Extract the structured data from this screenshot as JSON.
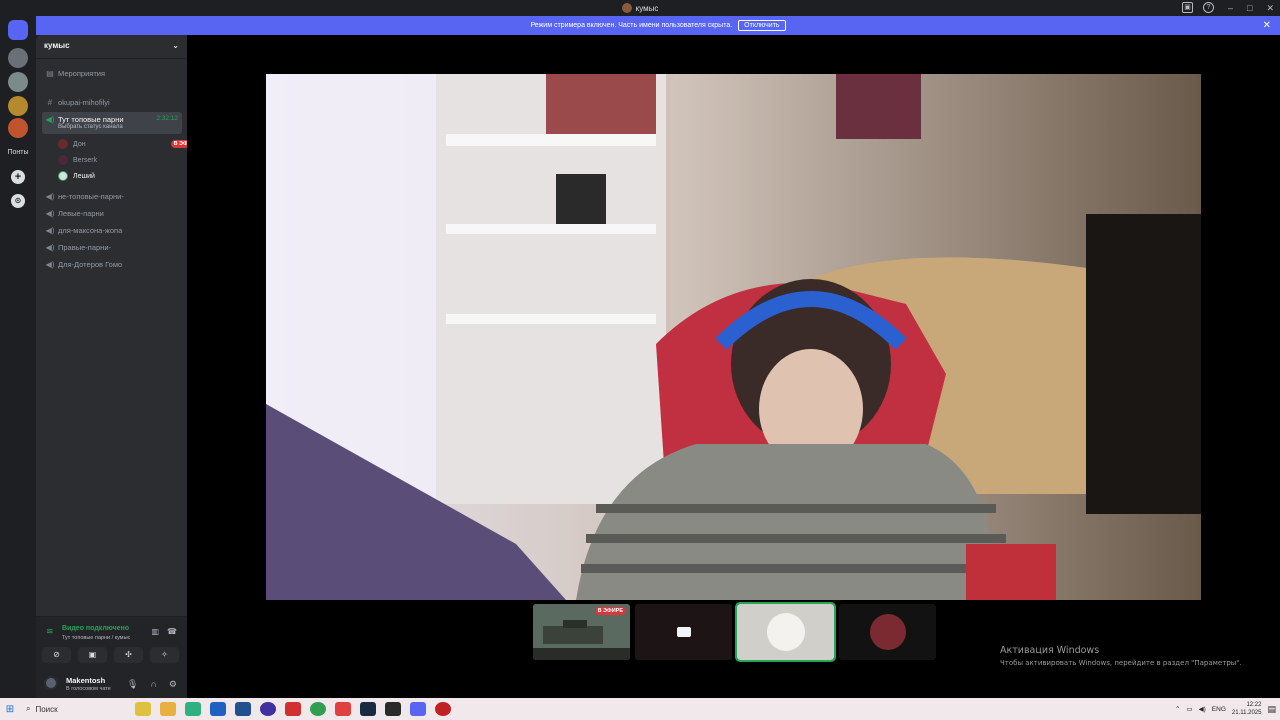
{
  "window": {
    "title": "кумыс"
  },
  "banner": {
    "text": "Режим стримера включен. Часть имени пользователя скрыта.",
    "button": "Отключить",
    "color": "#5865f2"
  },
  "rail": {
    "folder_label": "Понты"
  },
  "server": {
    "name": "кумыс"
  },
  "channels": {
    "events": "Мероприятия",
    "text_channel": "okupai-mihofilyi",
    "active_voice": {
      "name": "Тут топовые парни",
      "timer": "2:32:12",
      "status_hint": "Выбрать статус канала"
    },
    "members": [
      {
        "name": "Дон",
        "badge": "В ЭФИРЕ"
      },
      {
        "name": "Berserk"
      },
      {
        "name": "Леший"
      }
    ],
    "voice": [
      "не-топовые-парни-",
      "Левые-парни",
      "для-максона-жопа",
      "Правые-парни-",
      "Для-Дотеров Гомо"
    ]
  },
  "voice_panel": {
    "status": "Видео подключено",
    "channel": "Тут топовые парни / кумыс"
  },
  "user": {
    "name": "Makentosh",
    "status": "В голосовом чате"
  },
  "thumbnails": {
    "live_badge": "В ЭФИРЕ"
  },
  "activation": {
    "title": "Активация Windows",
    "text": "Чтобы активировать Windows, перейдите в раздел \"Параметры\"."
  },
  "taskbar": {
    "search": "Поиск",
    "lang": "ENG",
    "time": "12:22",
    "date": "21.11.2025"
  },
  "colors": {
    "accent": "#5865f2",
    "online": "#23a55a",
    "live": "#da373c"
  }
}
